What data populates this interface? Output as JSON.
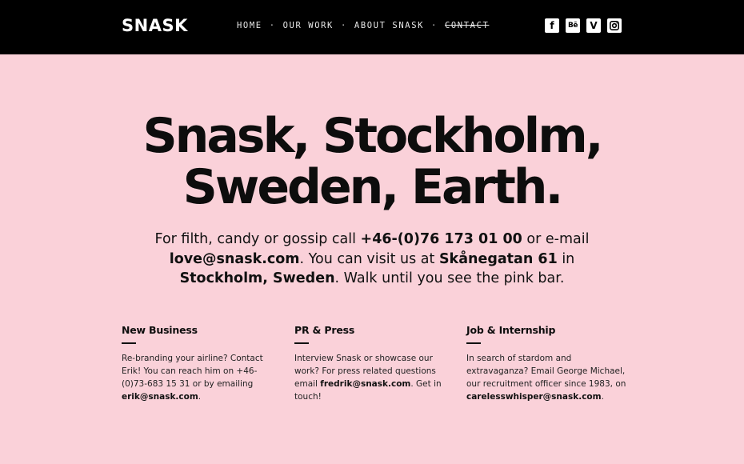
{
  "header": {
    "logo": "SNASK",
    "nav": [
      "HOME",
      "OUR WORK",
      "ABOUT SNASK",
      "CONTACT"
    ],
    "separator": "·",
    "social": [
      {
        "name": "facebook-icon",
        "glyph": "f"
      },
      {
        "name": "behance-icon",
        "glyph": "Bē"
      },
      {
        "name": "vimeo-icon",
        "glyph": "V"
      },
      {
        "name": "instagram-icon",
        "glyph": ""
      }
    ]
  },
  "hero": {
    "line1": "Snask, Stockholm,",
    "line2": "Sweden, Earth."
  },
  "intro": {
    "t1": "For filth, candy or gossip call ",
    "phone": "+46-(0)76 173 01 00",
    "t2": " or e-mail ",
    "email": "love@snask.com",
    "t3": ". You can visit us at ",
    "street": "Skånegatan 61",
    "t4": " in ",
    "city": "Stockholm, Sweden",
    "t5": ". Walk until you see the pink bar."
  },
  "columns": [
    {
      "title": "New Business",
      "text": "Re-branding your airline? Contact Erik! You can reach him on +46-(0)73-683 15 31 or by emailing ",
      "email": "erik@snask.com",
      "tail": "."
    },
    {
      "title": "PR & Press",
      "text": "Interview Snask or showcase our work? For press related questions email ",
      "email": "fredrik@snask.com",
      "tail": ". Get in touch!"
    },
    {
      "title": "Job & Internship",
      "text": "In search of stardom and extravaganza? Email George Michael, our recruitment officer since 1983, on ",
      "email": "carelesswhisper@snask.com",
      "tail": "."
    }
  ],
  "colors": {
    "background": "#fad1d9",
    "topbar": "#000000",
    "text": "#111111"
  }
}
